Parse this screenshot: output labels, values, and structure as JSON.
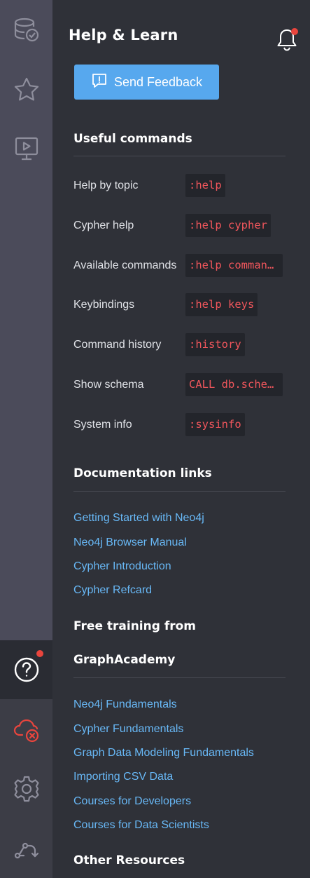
{
  "rail": {
    "items": [
      {
        "name": "database-icon"
      },
      {
        "name": "favorites-star-icon"
      },
      {
        "name": "guides-play-icon"
      }
    ],
    "bottom_items": [
      {
        "name": "help-icon",
        "active": true,
        "badge": true
      },
      {
        "name": "cloud-disconnected-icon"
      },
      {
        "name": "settings-gear-icon"
      },
      {
        "name": "connect-icon"
      }
    ],
    "colors": {
      "bg": "#4b4b5a",
      "bottom_bg": "#3c3d46",
      "active_bg": "#2a2c33",
      "badge": "#e9453d",
      "alert": "#e9453d"
    }
  },
  "drawer": {
    "title": "Help & Learn",
    "notification_badge": true,
    "feedback_label": "Send Feedback",
    "sections": {
      "commands": {
        "title": "Useful commands",
        "rows": [
          {
            "label": "Help by topic",
            "code": ":help"
          },
          {
            "label": "Cypher help",
            "code": ":help cypher"
          },
          {
            "label": "Available commands",
            "code": ":help commands"
          },
          {
            "label": "Keybindings",
            "code": ":help keys"
          },
          {
            "label": "Command history",
            "code": ":history"
          },
          {
            "label": "Show schema",
            "code": "CALL db.schema.visualization()"
          },
          {
            "label": "System info",
            "code": ":sysinfo"
          }
        ]
      },
      "docs": {
        "title": "Documentation links",
        "links": [
          "Getting Started with Neo4j",
          "Neo4j Browser Manual",
          "Cypher Introduction",
          "Cypher Refcard"
        ]
      },
      "training": {
        "title_line1": "Free training from",
        "title_line2": "GraphAcademy",
        "links": [
          "Neo4j Fundamentals",
          "Cypher Fundamentals",
          "Graph Data Modeling Fundamentals",
          "Importing CSV Data",
          "Courses for Developers",
          "Courses for Data Scientists"
        ]
      },
      "other": {
        "title": "Other Resources"
      }
    },
    "colors": {
      "accent": "#57a8ee",
      "link": "#68b8f6",
      "code": "#f0565c"
    }
  }
}
